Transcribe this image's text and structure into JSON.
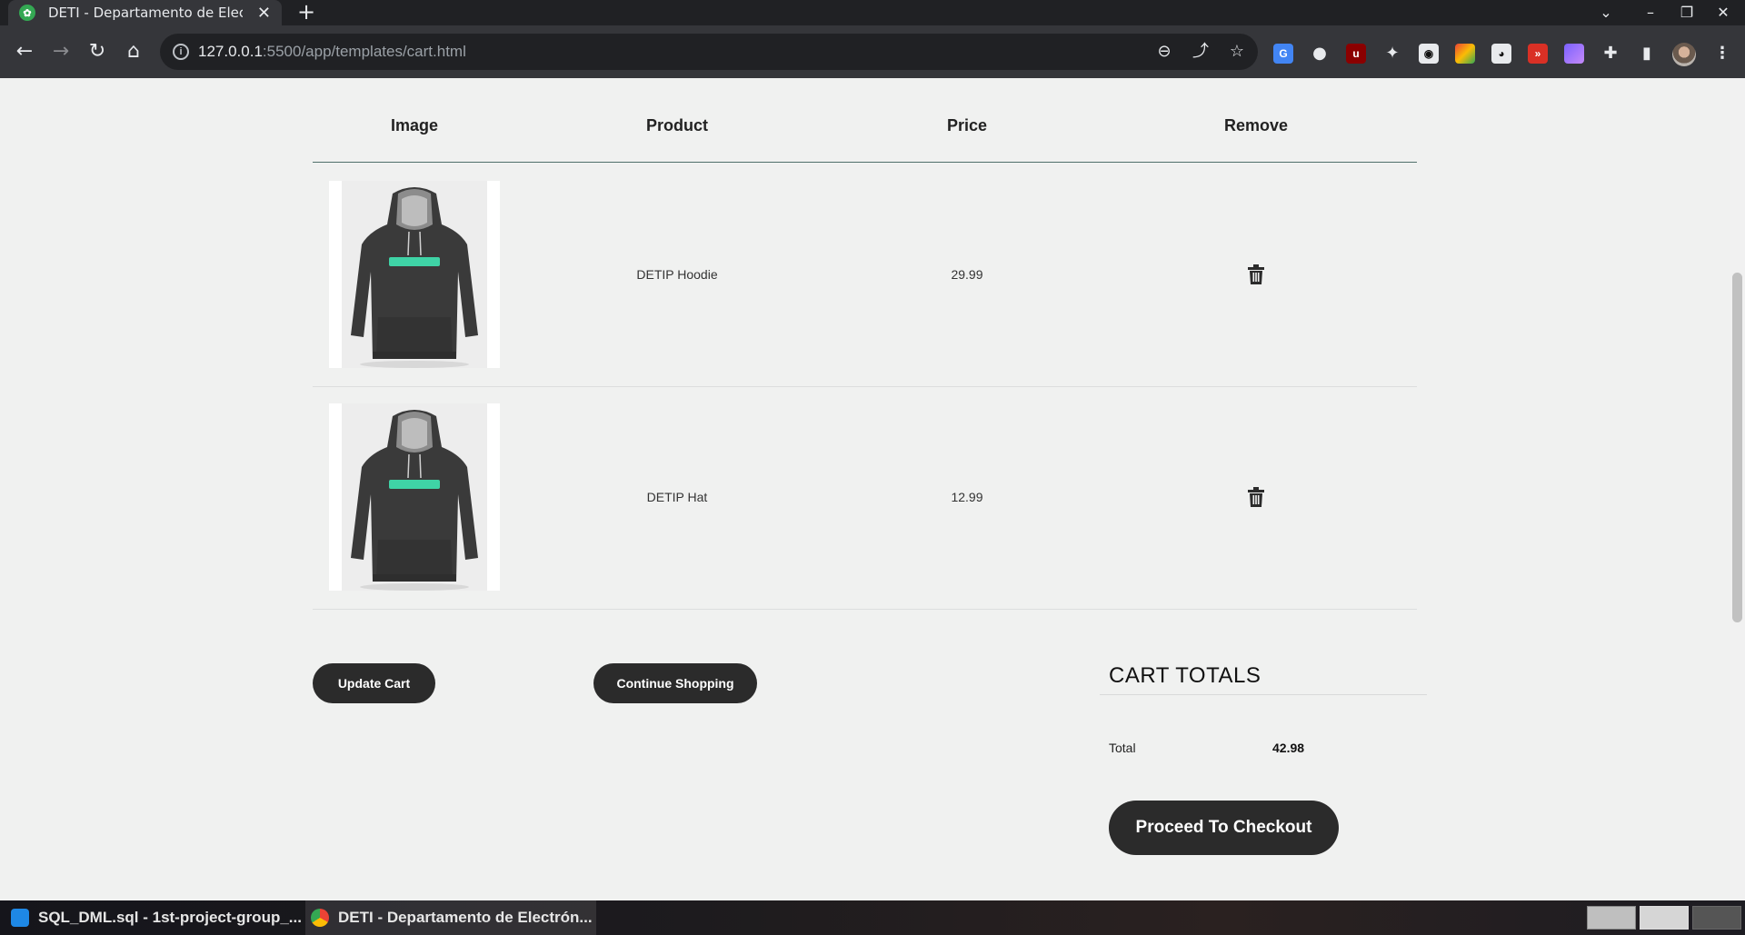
{
  "browser": {
    "tab_title": "DETI - Departamento de Electrónica",
    "url_host": "127.0.0.1",
    "url_path": ":5500/app/templates/cart.html",
    "info_glyph": "i",
    "window_controls": [
      "⌄",
      "–",
      "❐",
      "✕"
    ]
  },
  "cart": {
    "headers": {
      "image": "Image",
      "product": "Product",
      "price": "Price",
      "remove": "Remove"
    },
    "items": [
      {
        "name": "DETIP Hoodie",
        "price": "29.99"
      },
      {
        "name": "DETIP Hat",
        "price": "12.99"
      }
    ],
    "update_label": "Update Cart",
    "continue_label": "Continue Shopping"
  },
  "totals": {
    "title": "CART TOTALS",
    "total_label": "Total",
    "total_value": "42.98",
    "checkout_label": "Proceed To Checkout"
  },
  "taskbar": {
    "apps": [
      {
        "label": "SQL_DML.sql - 1st-project-group_...",
        "icon": "vscode-icon",
        "color": "#1e88e5"
      },
      {
        "label": "DETI - Departamento de Electrón...",
        "icon": "chrome-icon",
        "color": "#fbbc05"
      }
    ]
  },
  "colors": {
    "accent_dark": "#2b2b2b",
    "page_bg": "#f0f1f0",
    "hoodie_logo": "#3fd3a6"
  }
}
